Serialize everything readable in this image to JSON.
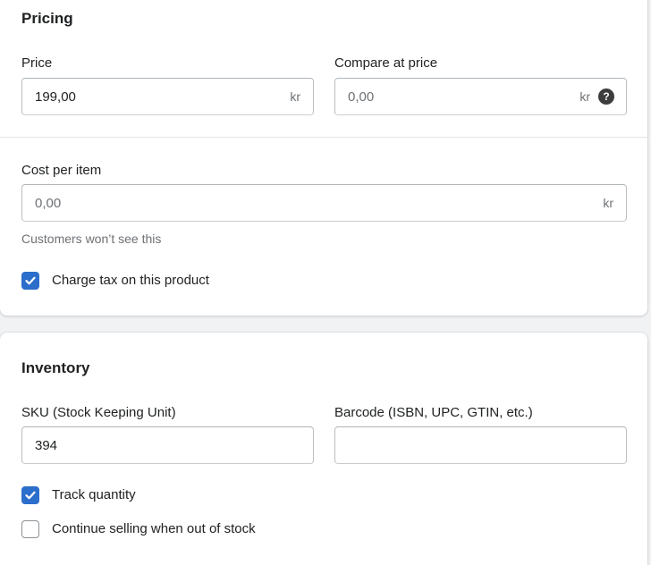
{
  "pricing": {
    "title": "Pricing",
    "price": {
      "label": "Price",
      "value": "199,00",
      "suffix": "kr"
    },
    "compare_at_price": {
      "label": "Compare at price",
      "placeholder": "0,00",
      "suffix": "kr",
      "help_icon": "question-circle-icon"
    },
    "cost_per_item": {
      "label": "Cost per item",
      "placeholder": "0,00",
      "suffix": "kr",
      "help_text": "Customers won’t see this"
    },
    "charge_tax": {
      "label": "Charge tax on this product",
      "checked": true
    }
  },
  "inventory": {
    "title": "Inventory",
    "sku": {
      "label": "SKU (Stock Keeping Unit)",
      "value": "394"
    },
    "barcode": {
      "label": "Barcode (ISBN, UPC, GTIN, etc.)",
      "value": ""
    },
    "track_quantity": {
      "label": "Track quantity",
      "checked": true
    },
    "continue_selling": {
      "label": "Continue selling when out of stock",
      "checked": false
    }
  },
  "colors": {
    "accent": "#2c6ecb",
    "border": "#babfc3",
    "subdued_text": "#6d7175"
  }
}
